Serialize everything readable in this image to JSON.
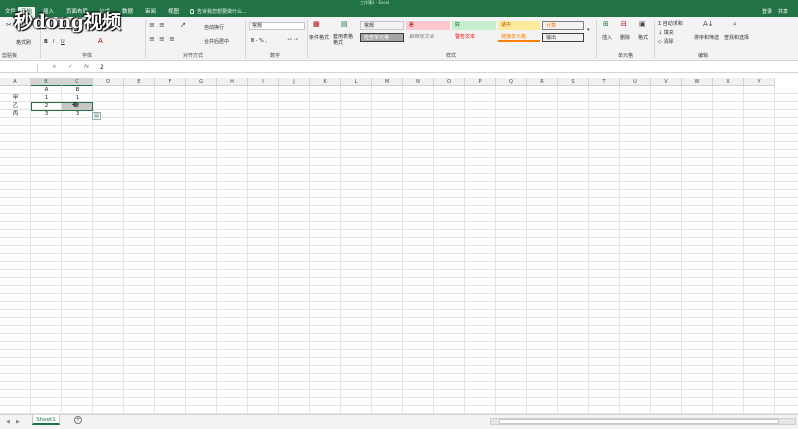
{
  "window": {
    "title": "工作簿1 - Excel"
  },
  "tabs": [
    "文件",
    "开始",
    "插入",
    "页面布局",
    "公式",
    "数据",
    "审阅",
    "视图"
  ],
  "active_tab_index": 1,
  "tell_me": "告诉我您想要做什么...",
  "account": {
    "login": "登录",
    "share": "共享"
  },
  "watermark": "秒dong视频",
  "ribbon": {
    "clipboard": {
      "label": "剪贴板",
      "format_painter": "格式刷"
    },
    "font": {
      "label": "字体"
    },
    "alignment": {
      "label": "对齐方式",
      "wrap": "自动换行",
      "merge": "合并后居中"
    },
    "number": {
      "label": "数字",
      "format": "常规"
    },
    "styles": {
      "label": "样式",
      "conditional": "条件格式",
      "table": "套用表格格式",
      "cells": [
        {
          "text": "常规",
          "bg": "#ffffff",
          "fg": "#222222"
        },
        {
          "text": "差",
          "bg": "#ffc7ce",
          "fg": "#9c0006"
        },
        {
          "text": "好",
          "bg": "#c6efce",
          "fg": "#006100"
        },
        {
          "text": "适中",
          "bg": "#ffeb9c",
          "fg": "#9c5700"
        },
        {
          "text": "计算",
          "bg": "#f2f2f2",
          "fg": "#fa7d00"
        },
        {
          "text": "检查单元格",
          "bg": "#a5a5a5",
          "fg": "#ffffff"
        },
        {
          "text": "解释性文本",
          "bg": "#ffffff",
          "fg": "#7f7f7f"
        },
        {
          "text": "警告文本",
          "bg": "#ffffff",
          "fg": "#ff0000"
        },
        {
          "text": "链接单元格",
          "bg": "#ffffff",
          "fg": "#fa7d00"
        },
        {
          "text": "输出",
          "bg": "#f2f2f2",
          "fg": "#3f3f3f"
        }
      ]
    },
    "cells": {
      "label": "单元格",
      "insert": "插入",
      "delete": "删除",
      "format": "格式"
    },
    "editing": {
      "label": "编辑",
      "autosum": "自动求和",
      "fill": "填充",
      "clear": "清除",
      "sort": "排序和筛选",
      "find": "查找和选择"
    }
  },
  "formula_bar": {
    "name_box": "",
    "cancel": "×",
    "enter": "✓",
    "fx": "fx",
    "value": "2"
  },
  "columns": [
    "A",
    "B",
    "C",
    "D",
    "E",
    "F",
    "G",
    "H",
    "I",
    "J",
    "K",
    "L",
    "M",
    "N",
    "O",
    "P",
    "Q",
    "R",
    "S",
    "T",
    "U",
    "V",
    "W",
    "X",
    "Y"
  ],
  "selected_columns": [
    "B",
    "C"
  ],
  "cells": [
    {
      "col": "B",
      "row": 1,
      "value": "A"
    },
    {
      "col": "C",
      "row": 1,
      "value": "B"
    },
    {
      "col": "A",
      "row": 2,
      "value": "甲"
    },
    {
      "col": "B",
      "row": 2,
      "value": "1"
    },
    {
      "col": "C",
      "row": 2,
      "value": "1"
    },
    {
      "col": "A",
      "row": 3,
      "value": "乙"
    },
    {
      "col": "B",
      "row": 3,
      "value": "2"
    },
    {
      "col": "C",
      "row": 3,
      "value": "2"
    },
    {
      "col": "A",
      "row": 4,
      "value": "丙"
    },
    {
      "col": "B",
      "row": 4,
      "value": "3"
    },
    {
      "col": "C",
      "row": 4,
      "value": "3"
    }
  ],
  "sheets": [
    "Sheet1"
  ],
  "quick_analysis_icon": "quick-analysis-icon"
}
